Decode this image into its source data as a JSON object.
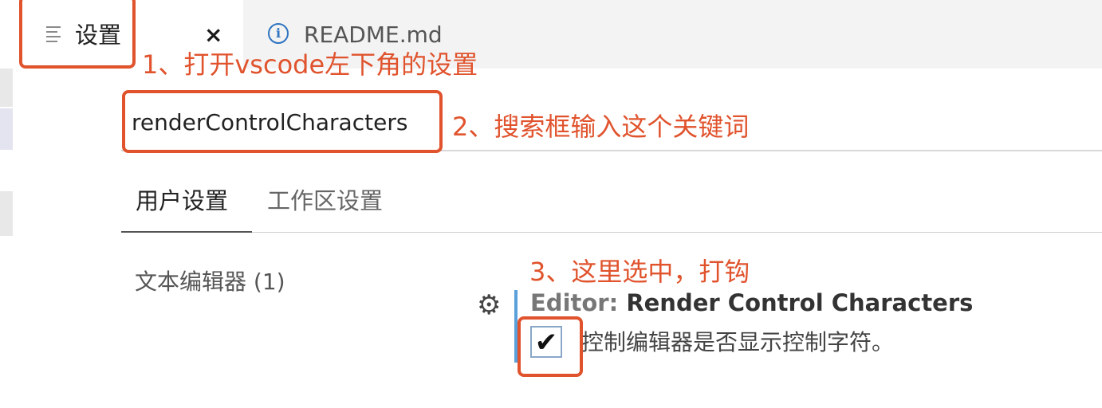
{
  "tabs": [
    {
      "icon": "settings-lines-icon",
      "title": "设置",
      "close": "×"
    },
    {
      "icon": "info-icon",
      "title": "README.md"
    }
  ],
  "search": {
    "value": "renderControlCharacters"
  },
  "scope_tabs": [
    "用户设置",
    "工作区设置"
  ],
  "toc": {
    "item": "文本编辑器 (1)"
  },
  "setting": {
    "category": "Editor:",
    "name": "Render Control Characters",
    "checked": true,
    "check_glyph": "✔",
    "description": "控制编辑器是否显示控制字符。"
  },
  "annotations": [
    "1、打开vscode左下角的设置",
    "2、搜索框输入这个关键词",
    "3、这里选中，打钩"
  ],
  "colors": {
    "annotation": "#e0532d",
    "setting_bar": "#5aa0da",
    "info": "#2f74c0"
  }
}
